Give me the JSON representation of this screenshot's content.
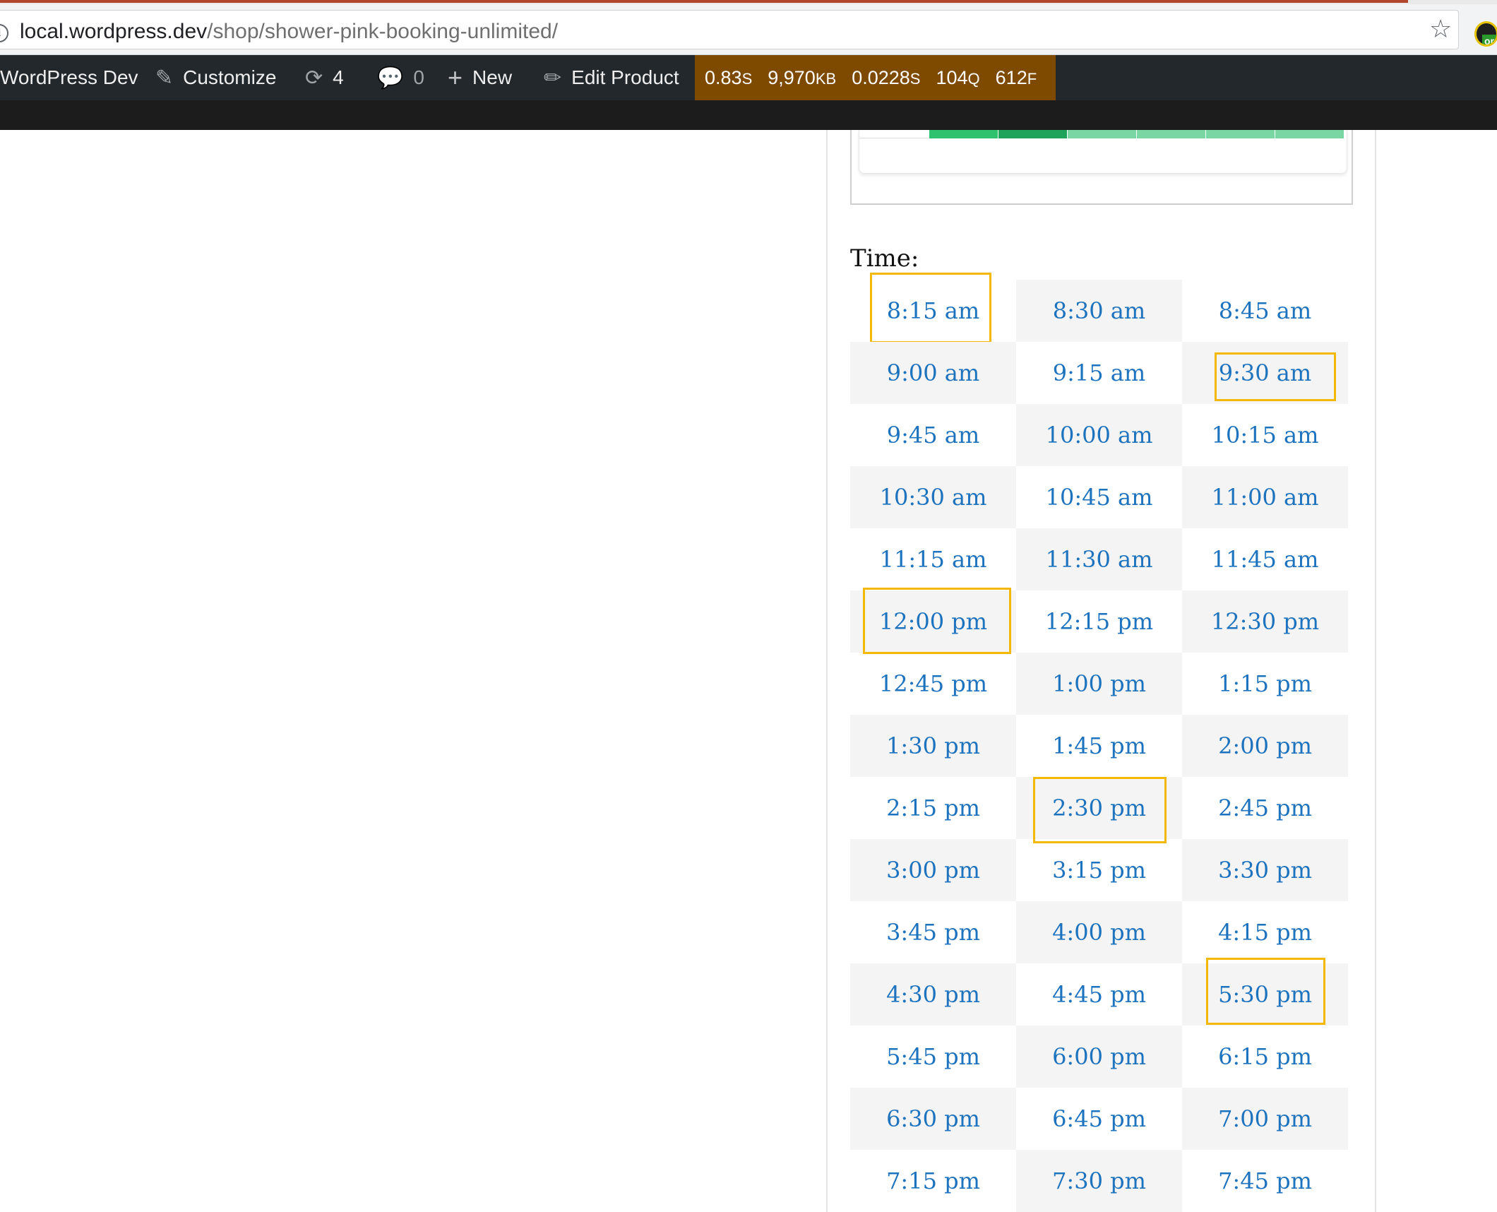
{
  "browser": {
    "url_host": "local.wordpress.dev",
    "url_path": "/shop/shower-pink-booking-unlimited/",
    "extension_badge": "or"
  },
  "admin_bar": {
    "site_name": "WordPress Dev",
    "customize_label": "Customize",
    "updates_count": "4",
    "comments_count": "0",
    "new_label": "New",
    "edit_label": "Edit Product",
    "query_monitor": {
      "time": "0.83",
      "time_unit": "S",
      "memory": "9,970",
      "memory_unit": "KB",
      "db_time": "0.0228",
      "db_time_unit": "S",
      "queries": "104",
      "queries_unit": "Q",
      "files": "612",
      "files_unit": "F"
    }
  },
  "booking": {
    "time_label": "Time:",
    "slots": [
      "8:15 am",
      "8:30 am",
      "8:45 am",
      "9:00 am",
      "9:15 am",
      "9:30 am",
      "9:45 am",
      "10:00 am",
      "10:15 am",
      "10:30 am",
      "10:45 am",
      "11:00 am",
      "11:15 am",
      "11:30 am",
      "11:45 am",
      "12:00 pm",
      "12:15 pm",
      "12:30 pm",
      "12:45 pm",
      "1:00 pm",
      "1:15 pm",
      "1:30 pm",
      "1:45 pm",
      "2:00 pm",
      "2:15 pm",
      "2:30 pm",
      "2:45 pm",
      "3:00 pm",
      "3:15 pm",
      "3:30 pm",
      "3:45 pm",
      "4:00 pm",
      "4:15 pm",
      "4:30 pm",
      "4:45 pm",
      "5:30 pm",
      "5:45 pm",
      "6:00 pm",
      "6:15 pm",
      "6:30 pm",
      "6:45 pm",
      "7:00 pm",
      "7:15 pm",
      "7:30 pm",
      "7:45 pm"
    ],
    "highlighted_slots": [
      "8:15 am",
      "9:30 am",
      "12:00 pm",
      "2:30 pm",
      "5:30 pm"
    ],
    "highlight_color": "#f5b800",
    "link_color": "#1e73be"
  }
}
